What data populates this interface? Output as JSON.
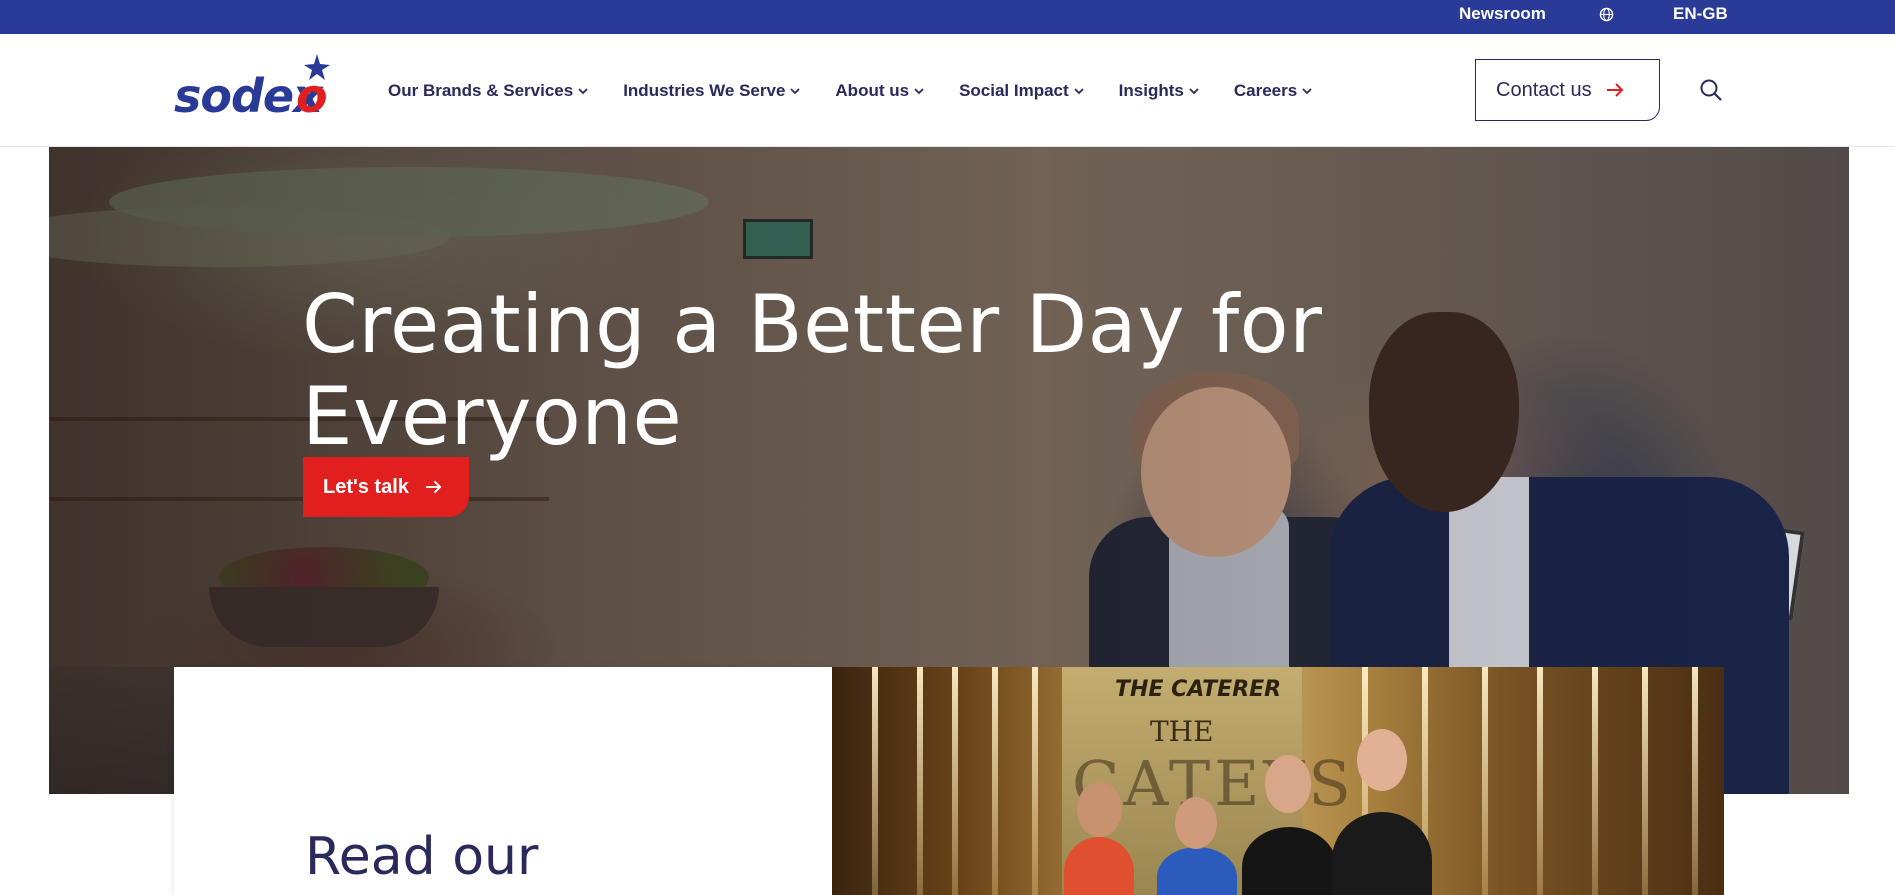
{
  "topbar": {
    "newsroom": "Newsroom",
    "globe_icon": "globe-icon",
    "language": "EN-GB",
    "bg_color": "#2a3a97"
  },
  "header": {
    "logo_text": "sodexo",
    "nav": [
      {
        "label": "Our Brands & Services"
      },
      {
        "label": "Industries We Serve"
      },
      {
        "label": "About us"
      },
      {
        "label": "Social Impact"
      },
      {
        "label": "Insights"
      },
      {
        "label": "Careers"
      }
    ],
    "contact_label": "Contact us",
    "search_icon": "search-icon"
  },
  "hero": {
    "title_line1": "Creating a Better Day for",
    "title_line2": "Everyone",
    "cta_label": "Let's talk",
    "cta_color": "#e11f1f"
  },
  "feature": {
    "heading": "Read our",
    "image_text1": "THE CATERER",
    "image_text2": "THE",
    "image_text3": "CATEYS"
  },
  "colors": {
    "brand_navy": "#2a295c",
    "brand_blue": "#2a3a97",
    "accent_red": "#e11f1f"
  }
}
